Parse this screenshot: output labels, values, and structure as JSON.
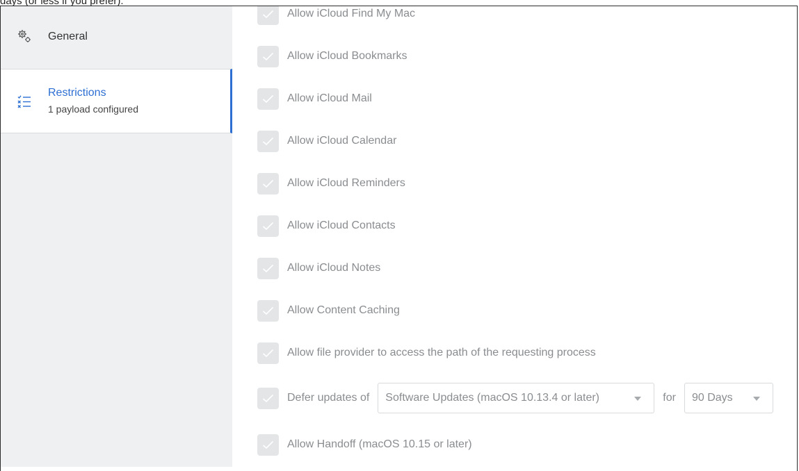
{
  "top_text": "days (or less if you prefer).",
  "sidebar": {
    "items": [
      {
        "label": "General",
        "icon": "gears-icon"
      },
      {
        "label": "Restrictions",
        "sub": "1 payload configured",
        "icon": "checklist-icon"
      }
    ]
  },
  "rows": {
    "find_my_mac": "Allow iCloud Find My Mac",
    "bookmarks": "Allow iCloud Bookmarks",
    "mail": "Allow iCloud Mail",
    "calendar": "Allow iCloud Calendar",
    "reminders": "Allow iCloud Reminders",
    "contacts": "Allow iCloud Contacts",
    "notes": "Allow iCloud Notes",
    "content_caching": "Allow Content Caching",
    "file_provider": "Allow file provider to access the path of the requesting process",
    "defer_updates": "Defer updates of",
    "handoff": "Allow Handoff (macOS 10.15 or later)"
  },
  "defer": {
    "type_value": "Software Updates (macOS 10.13.4 or later)",
    "for_label": "for",
    "days_value": "90 Days"
  },
  "colors": {
    "accent": "#2d6fd2",
    "sidebar_bg": "#eef0f1",
    "disabled_text": "#8a8d90",
    "checkbox_bg": "#e3e5e7"
  }
}
